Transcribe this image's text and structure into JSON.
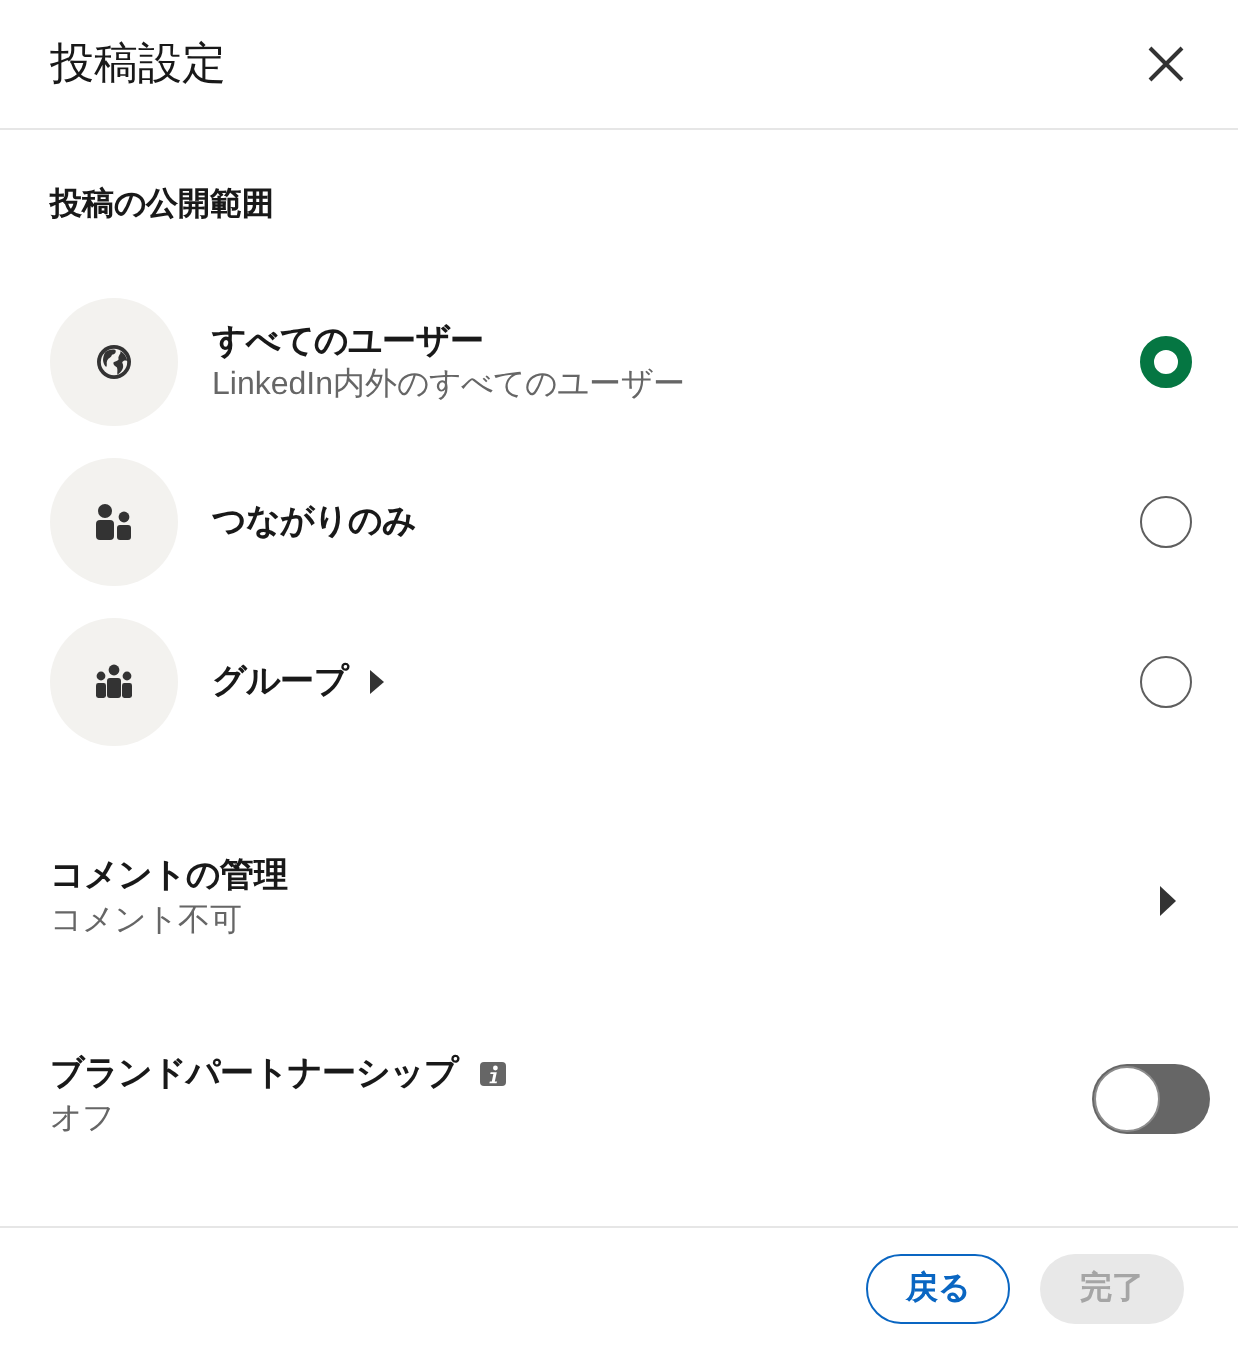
{
  "dialog": {
    "title": "投稿設定"
  },
  "visibility": {
    "heading": "投稿の公開範囲",
    "options": [
      {
        "kind": "everyone",
        "label": "すべてのユーザー",
        "description": "LinkedIn内外のすべてのユーザー",
        "has_submenu": false,
        "selected": true
      },
      {
        "kind": "connections",
        "label": "つながりのみ",
        "has_submenu": false,
        "selected": false
      },
      {
        "kind": "group",
        "label": "グループ",
        "has_submenu": true,
        "selected": false
      }
    ]
  },
  "settings": [
    {
      "kind": "submenu",
      "title": "コメントの管理",
      "value": "コメント不可"
    },
    {
      "kind": "toggle",
      "title": "ブランドパートナーシップ",
      "info": true,
      "value": "オフ",
      "on": false
    }
  ],
  "footer": {
    "buttons": [
      {
        "kind": "secondary",
        "label": "戻る",
        "disabled": false
      },
      {
        "kind": "primary",
        "label": "完了",
        "disabled": true
      }
    ]
  }
}
